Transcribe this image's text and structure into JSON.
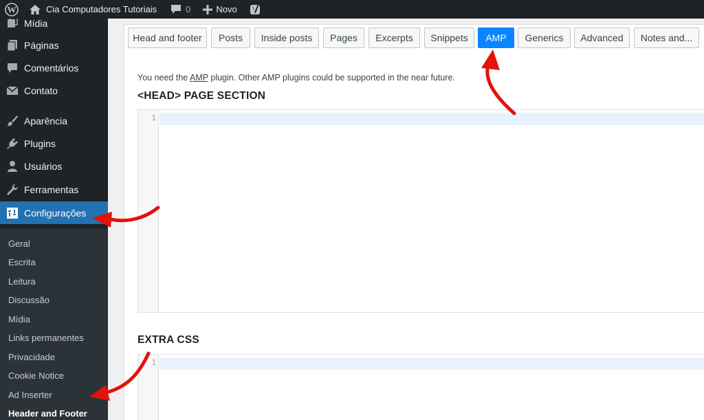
{
  "adminbar": {
    "site_name": "Cia Computadores Tutoriais",
    "comments_count": "0",
    "new_label": "Novo"
  },
  "sidebar": {
    "items": [
      {
        "label": "Mídia",
        "icon": "media-icon"
      },
      {
        "label": "Páginas",
        "icon": "pages-icon"
      },
      {
        "label": "Comentários",
        "icon": "comments-icon"
      },
      {
        "label": "Contato",
        "icon": "mail-icon"
      },
      {
        "label": "Aparência",
        "icon": "brush-icon"
      },
      {
        "label": "Plugins",
        "icon": "plugin-icon"
      },
      {
        "label": "Usuários",
        "icon": "users-icon"
      },
      {
        "label": "Ferramentas",
        "icon": "wrench-icon"
      },
      {
        "label": "Configurações",
        "icon": "settings-icon"
      }
    ],
    "submenu": [
      "Geral",
      "Escrita",
      "Leitura",
      "Discussão",
      "Mídia",
      "Links permanentes",
      "Privacidade",
      "Cookie Notice",
      "Ad Inserter",
      "Header and Footer"
    ]
  },
  "tabs": [
    "Head and footer",
    "Posts",
    "Inside posts",
    "Pages",
    "Excerpts",
    "Snippets",
    "AMP",
    "Generics",
    "Advanced",
    "Notes and..."
  ],
  "active_tab": "AMP",
  "notice": {
    "before": "You need the ",
    "link": "AMP",
    "after": " plugin. Other AMP plugins could be supported in the near future."
  },
  "sections": {
    "head_title": "<HEAD> PAGE SECTION",
    "css_title": "EXTRA CSS"
  },
  "editor": {
    "line1": "1"
  },
  "colors": {
    "admin_dark": "#1d2327",
    "active_blue": "#2271b1",
    "tab_active": "#0a84ff",
    "arrow_red": "#e3120b"
  }
}
